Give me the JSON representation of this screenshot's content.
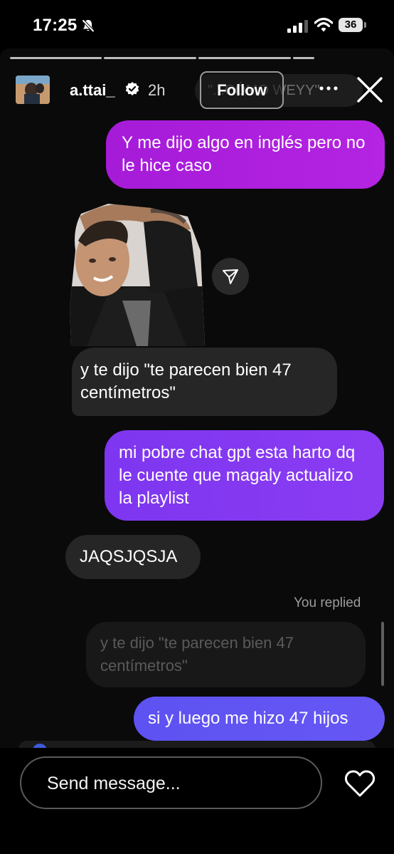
{
  "status_bar": {
    "time": "17:25",
    "battery": "36"
  },
  "header": {
    "username": "a.ttai_",
    "time_ago": "2h",
    "follow_label": "Follow",
    "background_pill_text": "\"...CÓMO WEYY\""
  },
  "messages": [
    {
      "text": "Y me dijo algo en inglés pero no le hice caso"
    },
    {
      "text": "y te dijo \"te parecen bien 47 centímetros\""
    },
    {
      "text": "mi pobre chat gpt esta harto dq le cuente que magaly actualizo la playlist"
    },
    {
      "text": "JAQSJQSJA"
    },
    {
      "text": "si y luego me hizo 47 hijos"
    }
  ],
  "reply": {
    "label": "You replied",
    "quoted_text": "y te dijo \"te parecen bien 47 centímetros\""
  },
  "composer": {
    "placeholder": "Send message..."
  },
  "icons": {
    "status": [
      "bell-slash-icon",
      "cellular-signal-icon",
      "wifi-icon",
      "battery-icon"
    ],
    "header": [
      "verified-badge-icon",
      "more-options-icon",
      "close-icon"
    ],
    "media": [
      "share-icon"
    ],
    "composer": [
      "heart-icon"
    ]
  },
  "colors": {
    "sent_bubble_1": "#ad1fdd",
    "sent_bubble_2": "#8438f1",
    "sent_bubble_3": "#6255f3",
    "received_bubble": "#262626",
    "background": "#000000"
  }
}
